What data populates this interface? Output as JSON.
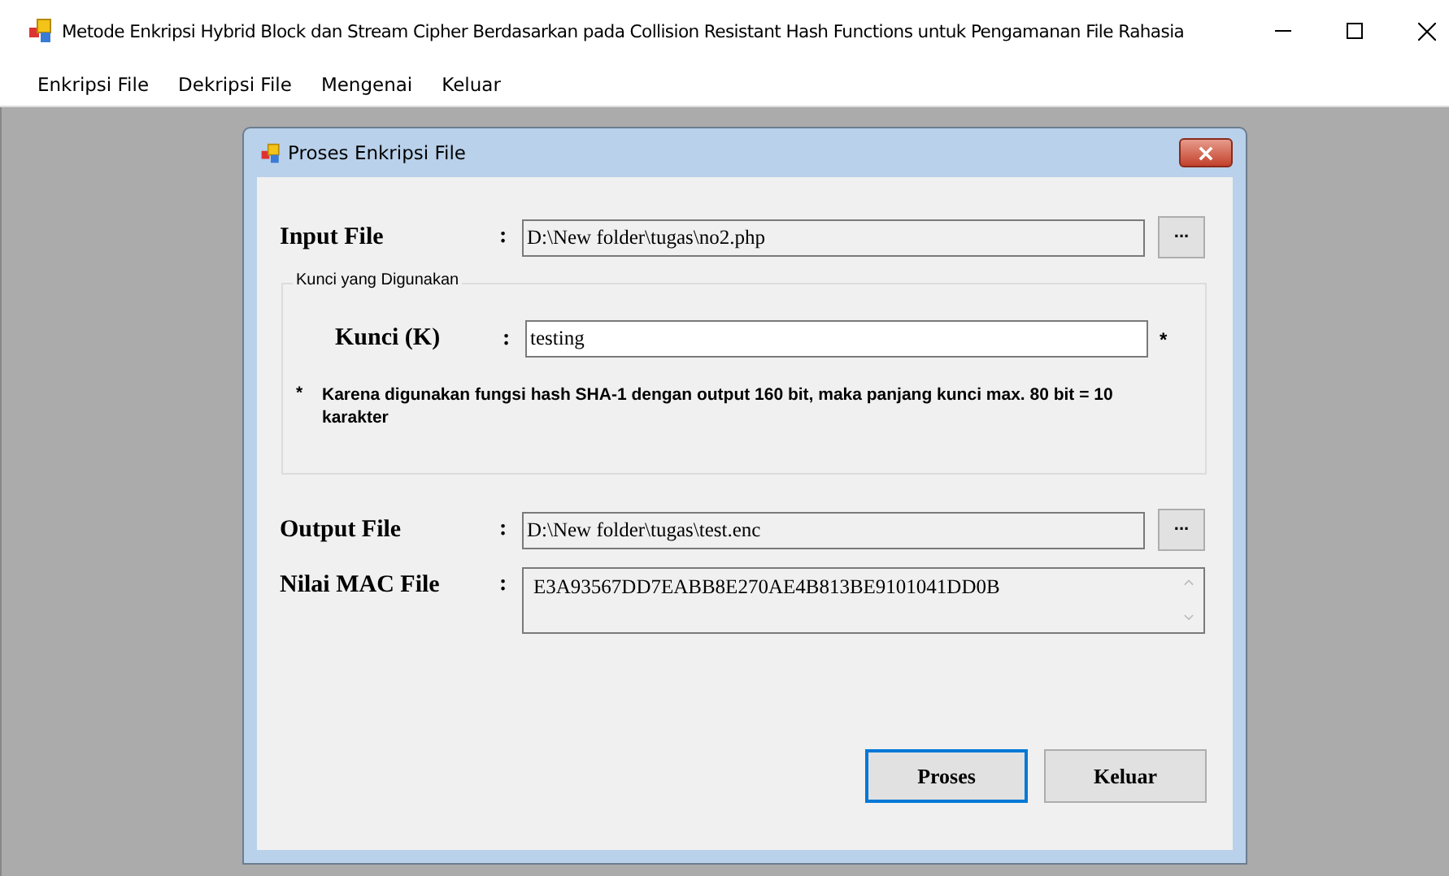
{
  "window": {
    "title": "Metode Enkripsi Hybrid Block dan Stream Cipher Berdasarkan pada Collision Resistant Hash Functions untuk Pengamanan File Rahasia"
  },
  "menu": [
    "Enkripsi File",
    "Dekripsi File",
    "Mengenai",
    "Keluar"
  ],
  "dialog": {
    "title": "Proses Enkripsi File",
    "input_file": {
      "label": "Input File",
      "colon": ":",
      "value": "D:\\New folder\\tugas\\no2.php",
      "browse": "..."
    },
    "key_group": {
      "legend": "Kunci yang Digunakan",
      "label": "Kunci (K)",
      "colon": ":",
      "value": "testing",
      "required_mark": "*",
      "note_mark": "*",
      "note": "Karena digunakan fungsi hash SHA-1 dengan output 160 bit, maka panjang kunci max. 80 bit = 10 karakter"
    },
    "output_file": {
      "label": "Output File",
      "colon": ":",
      "value": "D:\\New folder\\tugas\\test.enc",
      "browse": "..."
    },
    "mac": {
      "label": "Nilai MAC File",
      "colon": ":",
      "value": "E3A93567DD7EABB8E270AE4B813BE9101041DD0B"
    },
    "buttons": [
      {
        "label": "Proses",
        "selected": true
      },
      {
        "label": "Keluar",
        "selected": false
      }
    ]
  }
}
